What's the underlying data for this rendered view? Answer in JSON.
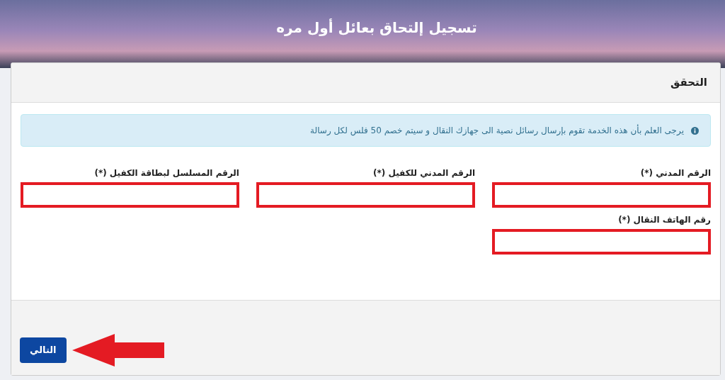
{
  "page_title": "تسجيل إلتحاق بعائل أول مره",
  "panel": {
    "heading": "التحقق"
  },
  "notice": {
    "text": "يرجى العلم بأن هذه الخدمة تقوم بإرسال رسائل نصية الى جهازك النقال و سيتم خصم 50 فلس لكل رسالة"
  },
  "fields": [
    {
      "label": "الرقم المدني (*)",
      "highlighted": true
    },
    {
      "label": "الرقم المدني للكفيل (*)",
      "highlighted": true
    },
    {
      "label": "الرقم المسلسل لبطاقة الكفيل (*)",
      "highlighted": true
    },
    {
      "label": "رقم الهاتف النقال (*)",
      "highlighted": true
    }
  ],
  "next_button": {
    "label": "التالي",
    "pointed_at": true
  }
}
